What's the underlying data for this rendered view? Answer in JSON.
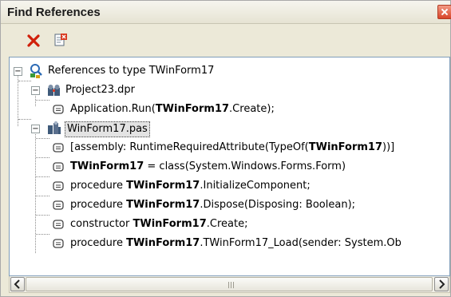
{
  "window": {
    "title": "Find References"
  },
  "toolbar": {
    "delete_icon": "red-x-icon",
    "clear_icon": "clear-results-icon"
  },
  "tree": {
    "root": {
      "label": "References to type TWinForm17",
      "icon": "references-icon",
      "expanded": true
    },
    "groups": [
      {
        "label": "Project23.dpr",
        "icon": "project-icon",
        "expanded": true,
        "items": [
          {
            "pre": "Application.Run(",
            "bold": "TWinForm17",
            "post": ".Create);"
          }
        ]
      },
      {
        "label": "WinForm17.pas",
        "icon": "unit-file-icon",
        "expanded": true,
        "selected": true,
        "items": [
          {
            "pre": "[assembly: RuntimeRequiredAttribute(TypeOf(",
            "bold": "TWinForm17",
            "post": "))]"
          },
          {
            "pre": "",
            "bold": "TWinForm17",
            "post": " = class(System.Windows.Forms.Form)"
          },
          {
            "pre": "procedure ",
            "bold": "TWinForm17",
            "post": ".InitializeComponent;"
          },
          {
            "pre": "procedure ",
            "bold": "TWinForm17",
            "post": ".Dispose(Disposing: Boolean);"
          },
          {
            "pre": "constructor ",
            "bold": "TWinForm17",
            "post": ".Create;"
          },
          {
            "pre": "procedure ",
            "bold": "TWinForm17",
            "post": ".TWinForm17_Load(sender: System.Ob"
          }
        ]
      }
    ]
  },
  "colors": {
    "panel": "#ece9d8",
    "tree_bg": "#ffffff",
    "close_red": "#d8452a"
  }
}
